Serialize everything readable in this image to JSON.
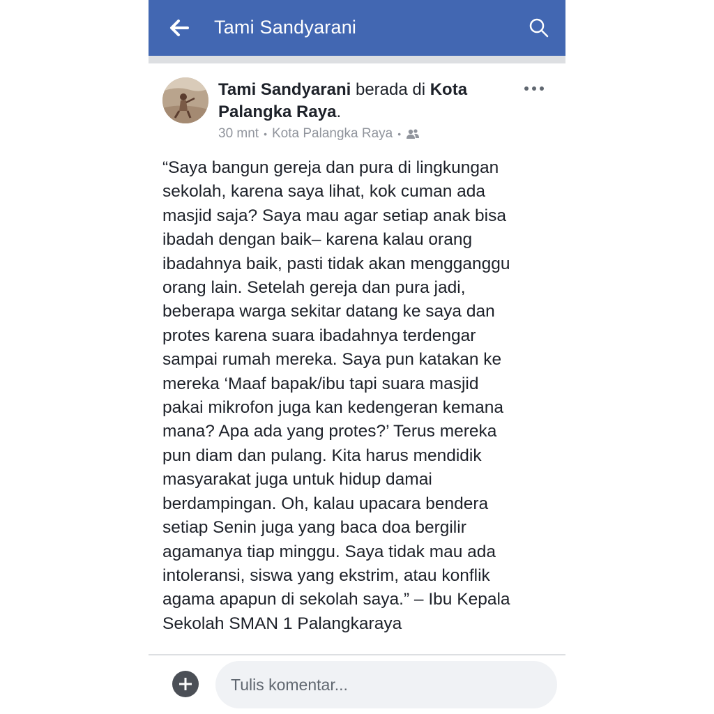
{
  "topbar": {
    "title": "Tami Sandyarani",
    "back_icon": "arrow-left-icon",
    "search_icon": "search-icon",
    "background": "#4267b2"
  },
  "post": {
    "author": "Tami Sandyarani",
    "location_connector": " berada di ",
    "location": "Kota Palangka Raya",
    "location_end": ".",
    "time": "30 mnt",
    "place": "Kota Palangka Raya",
    "audience_icon": "friends-icon",
    "more_icon": "more-horizontal-icon",
    "body": "“Saya bangun gereja dan pura di lingkungan\nsekolah, karena saya lihat, kok cuman ada\nmasjid saja? Saya mau agar setiap anak bisa\nibadah dengan baik– karena kalau orang\nibadahnya baik, pasti tidak akan mengganggu\norang lain. Setelah gereja dan pura jadi,\nbeberapa warga sekitar datang ke saya dan\nprotes karena suara ibadahnya terdengar\nsampai rumah mereka. Saya pun katakan ke\nmereka ‘Maaf bapak/ibu tapi suara masjid\npakai mikrofon juga kan kedengeran kemana\nmana? Apa ada yang protes?’ Terus mereka\npun diam dan pulang. Kita harus mendidik\nmasyarakat juga untuk hidup damai\nberdampingan. Oh, kalau upacara bendera\nsetiap Senin juga yang baca doa bergilir\nagamanya tiap minggu. Saya tidak mau ada\nintoleransi, siswa yang ekstrim, atau konflik\nagama apapun di sekolah saya.” – Ibu Kepala\nSekolah SMAN 1 Palangkaraya"
  },
  "comment": {
    "add_icon": "plus-circle-icon",
    "placeholder": "Tulis komentar..."
  }
}
